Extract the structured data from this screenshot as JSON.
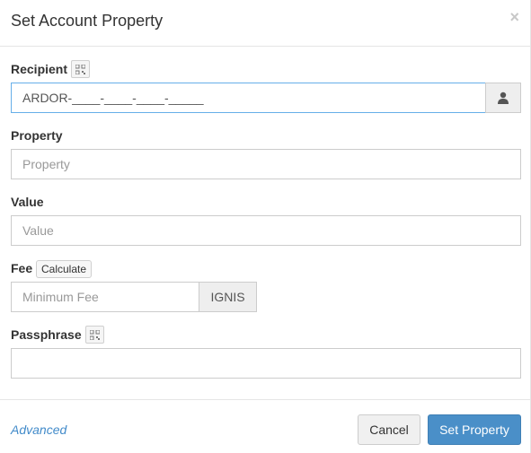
{
  "header": {
    "title": "Set Account Property",
    "close_label": "×"
  },
  "recipient": {
    "label": "Recipient",
    "value": "ARDOR-____-____-____-_____"
  },
  "property": {
    "label": "Property",
    "placeholder": "Property"
  },
  "value_field": {
    "label": "Value",
    "placeholder": "Value"
  },
  "fee": {
    "label": "Fee",
    "calculate_label": "Calculate",
    "placeholder": "Minimum Fee",
    "currency": "IGNIS"
  },
  "passphrase": {
    "label": "Passphrase",
    "value": ""
  },
  "footer": {
    "advanced_label": "Advanced",
    "cancel_label": "Cancel",
    "submit_label": "Set Property"
  },
  "colors": {
    "primary": "#4a8fc8",
    "link": "#428bca",
    "focus_border": "#66afe9"
  }
}
